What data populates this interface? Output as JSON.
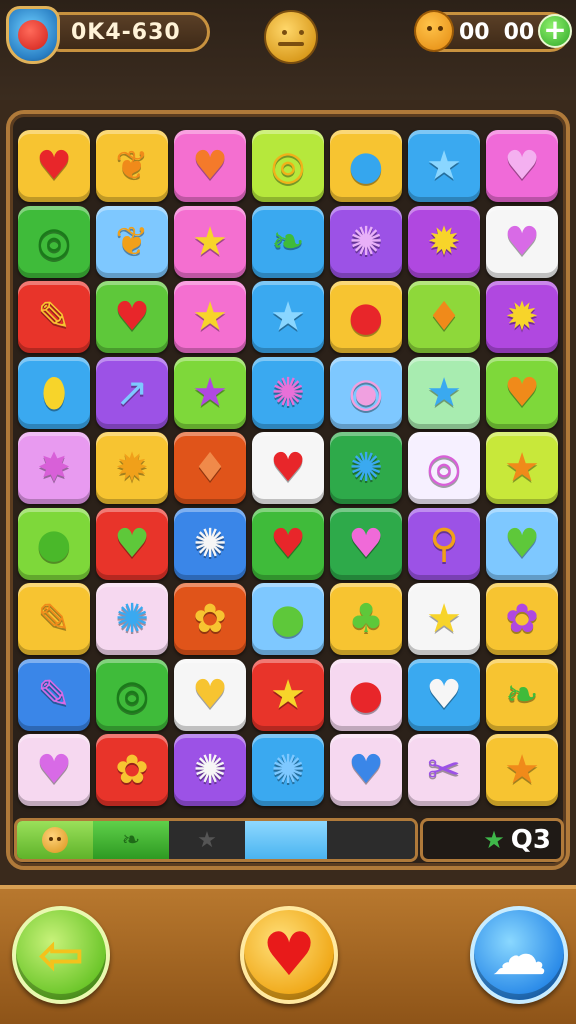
{
  "header": {
    "score_text": "0K4-630",
    "coins_value_1": "00",
    "coins_value_2": "00",
    "plus_label": "+"
  },
  "progress": {
    "moves_label": "Q3"
  },
  "board": {
    "rows": [
      [
        {
          "glyph": "♥",
          "bg": "#f7c431",
          "fg": "#e8262a"
        },
        {
          "glyph": "❦",
          "bg": "#f7c431",
          "fg": "#f08a1a"
        },
        {
          "glyph": "♥",
          "bg": "#f46fd0",
          "fg": "#f47a2a"
        },
        {
          "glyph": "◎",
          "bg": "#b6e83c",
          "fg": "#f0b21a"
        },
        {
          "glyph": "●",
          "bg": "#f7c431",
          "fg": "#35a6ee"
        },
        {
          "glyph": "★",
          "bg": "#3aa9f0",
          "fg": "#8ad6ff"
        },
        {
          "glyph": "♥",
          "bg": "#f06ad8",
          "fg": "#f4b0f0"
        }
      ],
      [
        {
          "glyph": "◎",
          "bg": "#3fbb3a",
          "fg": "#1a7a1a"
        },
        {
          "glyph": "❦",
          "bg": "#7ec8ff",
          "fg": "#f0a01a"
        },
        {
          "glyph": "★",
          "bg": "#f46fd0",
          "fg": "#f7d42a"
        },
        {
          "glyph": "❧",
          "bg": "#3aa9f0",
          "fg": "#3fbb3a"
        },
        {
          "glyph": "✺",
          "bg": "#9c52e6",
          "fg": "#e8b0f8"
        },
        {
          "glyph": "✹",
          "bg": "#b048e0",
          "fg": "#f7d42a"
        },
        {
          "glyph": "♥",
          "bg": "#f6f6f6",
          "fg": "#d86ae6"
        }
      ],
      [
        {
          "glyph": "✎",
          "bg": "#e8342a",
          "fg": "#f7c431"
        },
        {
          "glyph": "♥",
          "bg": "#5ec83a",
          "fg": "#e8262a"
        },
        {
          "glyph": "★",
          "bg": "#f46fd0",
          "fg": "#f7d42a"
        },
        {
          "glyph": "★",
          "bg": "#3aa9f0",
          "fg": "#8ad6ff"
        },
        {
          "glyph": "●",
          "bg": "#f7c431",
          "fg": "#e8262a"
        },
        {
          "glyph": "♦",
          "bg": "#8ed83a",
          "fg": "#f08a1a"
        },
        {
          "glyph": "✹",
          "bg": "#b048e0",
          "fg": "#f7d42a"
        }
      ],
      [
        {
          "glyph": "⬮",
          "bg": "#3aa9f0",
          "fg": "#f7d42a"
        },
        {
          "glyph": "↗",
          "bg": "#9c52e6",
          "fg": "#7ec8ff"
        },
        {
          "glyph": "★",
          "bg": "#7ed83a",
          "fg": "#b048e0"
        },
        {
          "glyph": "✺",
          "bg": "#3aa9f0",
          "fg": "#e870d8"
        },
        {
          "glyph": "◉",
          "bg": "#7ec8ff",
          "fg": "#f0a0e0"
        },
        {
          "glyph": "★",
          "bg": "#a8ecb0",
          "fg": "#3aa9f0"
        },
        {
          "glyph": "♥",
          "bg": "#7ed83a",
          "fg": "#f08a1a"
        }
      ],
      [
        {
          "glyph": "✸",
          "bg": "#e89af0",
          "fg": "#d860d8"
        },
        {
          "glyph": "✹",
          "bg": "#f7c431",
          "fg": "#f0a01a"
        },
        {
          "glyph": "♦",
          "bg": "#e0541a",
          "fg": "#f08a4a"
        },
        {
          "glyph": "♥",
          "bg": "#f6f6f6",
          "fg": "#e8262a"
        },
        {
          "glyph": "✺",
          "bg": "#2eaa4a",
          "fg": "#3aa9f0"
        },
        {
          "glyph": "◎",
          "bg": "#f6f0ff",
          "fg": "#d860d8"
        },
        {
          "glyph": "★",
          "bg": "#c8e83a",
          "fg": "#f08a1a"
        }
      ],
      [
        {
          "glyph": "●",
          "bg": "#7ed83a",
          "fg": "#4ab82a"
        },
        {
          "glyph": "♥",
          "bg": "#e8342a",
          "fg": "#5ec83a"
        },
        {
          "glyph": "✺",
          "bg": "#3a86e8",
          "fg": "#f6f6f6"
        },
        {
          "glyph": "♥",
          "bg": "#3fbb3a",
          "fg": "#e8262a"
        },
        {
          "glyph": "♥",
          "bg": "#2eaa4a",
          "fg": "#f06ad8"
        },
        {
          "glyph": "⚲",
          "bg": "#9c52e6",
          "fg": "#f0a01a"
        },
        {
          "glyph": "♥",
          "bg": "#7ec8ff",
          "fg": "#5ec83a"
        }
      ],
      [
        {
          "glyph": "✎",
          "bg": "#f7c431",
          "fg": "#f08a1a"
        },
        {
          "glyph": "✺",
          "bg": "#f6d8f0",
          "fg": "#3aa9f0"
        },
        {
          "glyph": "✿",
          "bg": "#e0541a",
          "fg": "#f7c431"
        },
        {
          "glyph": "●",
          "bg": "#7ec8ff",
          "fg": "#5ec83a"
        },
        {
          "glyph": "♣",
          "bg": "#f7c431",
          "fg": "#5ec83a"
        },
        {
          "glyph": "★",
          "bg": "#f6f6f6",
          "fg": "#f7d42a"
        },
        {
          "glyph": "✿",
          "bg": "#f7c431",
          "fg": "#b048e0"
        }
      ],
      [
        {
          "glyph": "✎",
          "bg": "#3a86e8",
          "fg": "#d86ae6"
        },
        {
          "glyph": "◎",
          "bg": "#3fbb3a",
          "fg": "#1a7a1a"
        },
        {
          "glyph": "♥",
          "bg": "#f6f6f6",
          "fg": "#f7c431"
        },
        {
          "glyph": "★",
          "bg": "#e8342a",
          "fg": "#f7d42a"
        },
        {
          "glyph": "●",
          "bg": "#f6d8f0",
          "fg": "#e8262a"
        },
        {
          "glyph": "♥",
          "bg": "#3aa9f0",
          "fg": "#f6f6f6"
        },
        {
          "glyph": "❧",
          "bg": "#f7c431",
          "fg": "#3fbb3a"
        }
      ],
      [
        {
          "glyph": "♥",
          "bg": "#f6d8f0",
          "fg": "#d86ae6"
        },
        {
          "glyph": "✿",
          "bg": "#e8342a",
          "fg": "#f7c431"
        },
        {
          "glyph": "✺",
          "bg": "#9c52e6",
          "fg": "#f6f6f6"
        },
        {
          "glyph": "✺",
          "bg": "#3aa9f0",
          "fg": "#7ec8ff"
        },
        {
          "glyph": "♥",
          "bg": "#f6d8f0",
          "fg": "#3a86e8"
        },
        {
          "glyph": "✂",
          "bg": "#f6d8f0",
          "fg": "#9c52e6"
        },
        {
          "glyph": "★",
          "bg": "#f7c431",
          "fg": "#f08a1a"
        }
      ]
    ]
  },
  "buttons": {
    "back_icon": "⇦",
    "heart_icon": "♥",
    "cloud_icon": "☁"
  },
  "colors": {
    "frame": "#b07a3a",
    "background": "#3a2a1c"
  }
}
